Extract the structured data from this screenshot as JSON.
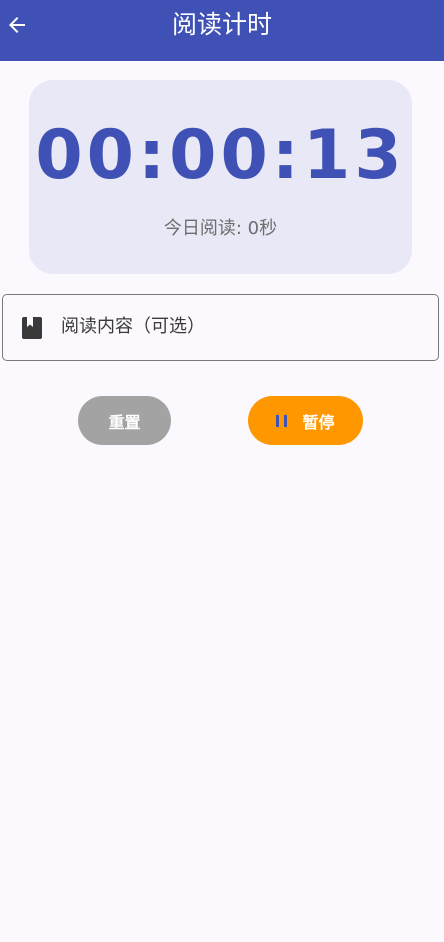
{
  "app_bar": {
    "title": "阅读计时",
    "back_icon": "arrow-left-icon",
    "background": "#3F51B5"
  },
  "timer": {
    "value": "00:00:13",
    "today_label": "今日阅读: 0秒",
    "accent": "#3F51B5"
  },
  "content_field": {
    "icon": "book-icon",
    "placeholder": "阅读内容（可选）"
  },
  "controls": {
    "reset_label": "重置",
    "reset_color": "#A3A3A3",
    "pause_label": "暂停",
    "pause_icon": "pause-icon",
    "pause_color": "#FF9800"
  }
}
